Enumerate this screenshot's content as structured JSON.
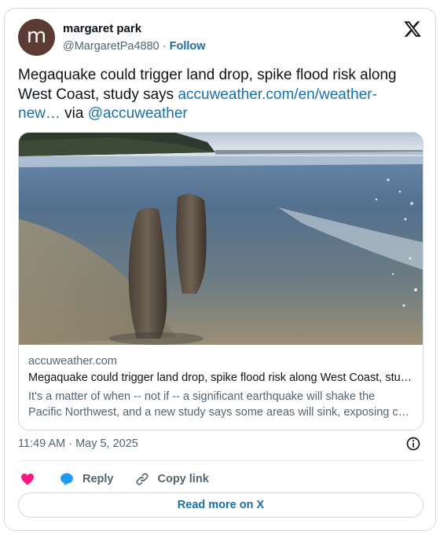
{
  "author": {
    "avatar_letter": "m",
    "display_name": "margaret park",
    "handle": "@MargaretPa4880",
    "separator": "·",
    "follow_label": "Follow"
  },
  "tweet": {
    "text": "Megaquake could trigger land drop, spike flood risk along West Coast, study says ",
    "link_text": "accuweather.com/en/weather-new…",
    "via_text": " via ",
    "mention": "@accuweather"
  },
  "link_card": {
    "image_alt": "ghost forest stumps in shallow ocean water",
    "domain": "accuweather.com",
    "title": "Megaquake could trigger land drop, spike flood risk along West Coast, study says",
    "description_line1": "It's a matter of when -- not if -- a significant earthquake will shake the",
    "description_line2": "Pacific Northwest, and a new study says some areas will sink, exposing coastal communities"
  },
  "meta": {
    "timestamp": "11:49 AM · May 5, 2025"
  },
  "actions": {
    "reply_label": "Reply",
    "copy_label": "Copy link",
    "read_more_label": "Read more on X"
  },
  "colors": {
    "link": "#1b6fa3",
    "heart": "#f91880",
    "reply_bubble": "#1d9bf0",
    "avatar_bg": "#5b3b34"
  }
}
